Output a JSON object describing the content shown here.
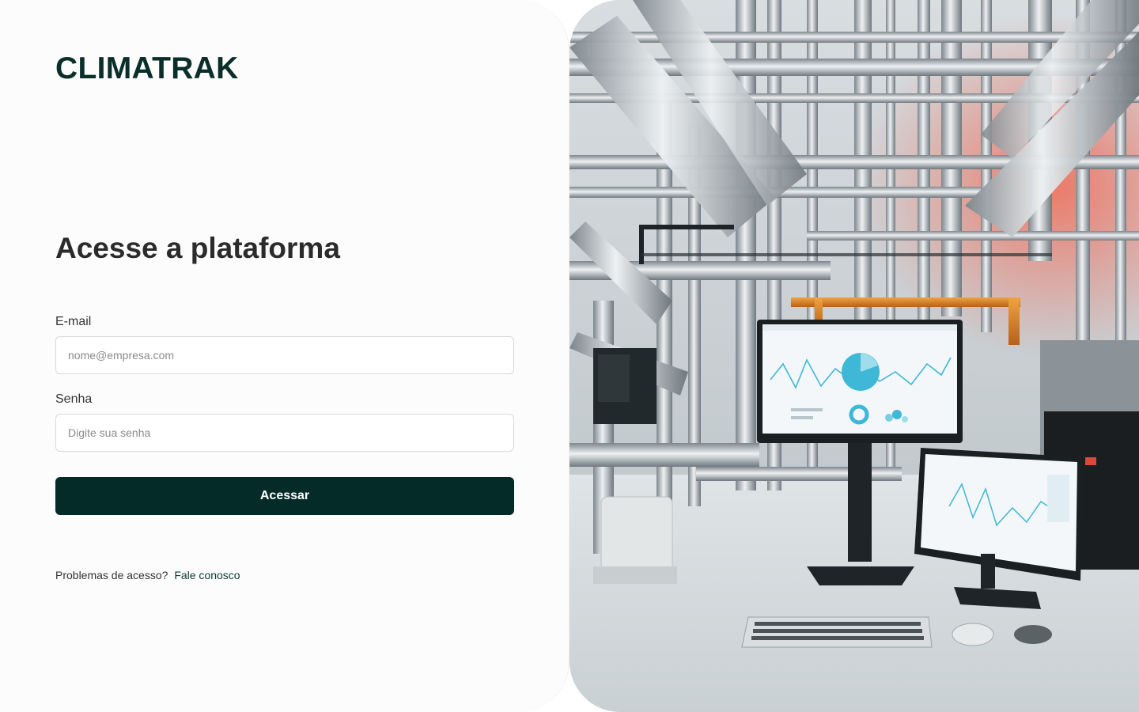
{
  "brand": {
    "logo_text": "CLIMATRAK"
  },
  "login": {
    "title": "Acesse a plataforma",
    "email_label": "E-mail",
    "email_placeholder": "nome@empresa.com",
    "email_value": "",
    "password_label": "Senha",
    "password_placeholder": "Digite sua senha",
    "password_value": "",
    "submit_label": "Acessar",
    "help_text": "Problemas de acesso?",
    "help_link": "Fale conosco"
  },
  "hero": {
    "image_subject": "industrial-hvac-piping-room-with-monitoring-screens"
  },
  "colors": {
    "brand_dark": "#052b28",
    "logo": "#0a2e2a",
    "title": "#2b2b2b",
    "accent_screen": "#3fb7d6"
  }
}
